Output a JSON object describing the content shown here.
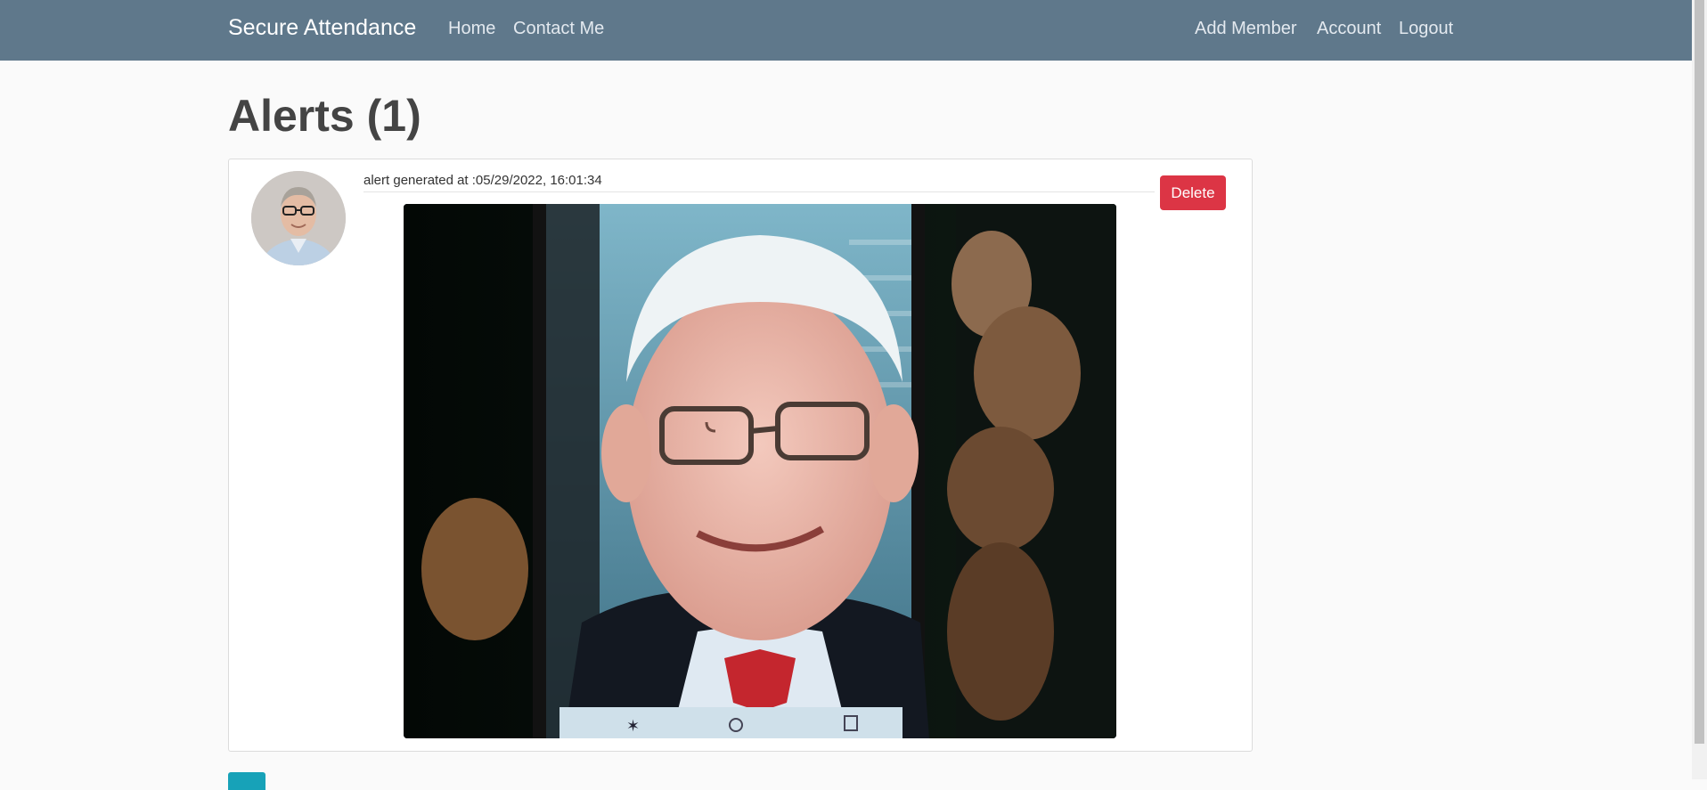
{
  "navbar": {
    "brand": "Secure Attendance",
    "links_left": [
      "Home",
      "Contact Me"
    ],
    "links_right": [
      "Add Member",
      "Account",
      "Logout"
    ]
  },
  "page": {
    "title": "Alerts (1)"
  },
  "alerts": [
    {
      "timestamp_text": "alert generated at :05/29/2022, 16:01:34",
      "delete_label": "Delete"
    }
  ],
  "colors": {
    "navbar": "#5f788b",
    "delete": "#dc3545",
    "pager": "#17a2b8"
  }
}
